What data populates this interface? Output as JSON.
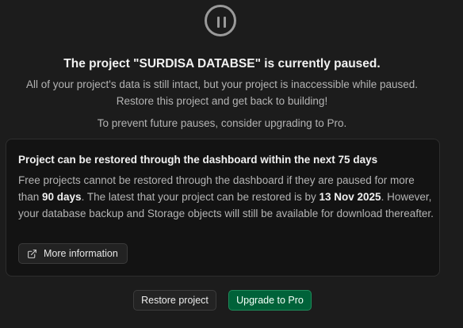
{
  "header": {
    "icon": "pause-circle-icon",
    "title": "The project \"SURDISA DATABSE\" is currently paused.",
    "description_line1": "All of your project's data is still intact, but your project is inaccessible while paused.",
    "description_line2": "Restore this project and get back to building!",
    "upgrade_hint": "To prevent future pauses, consider upgrading to Pro."
  },
  "notice": {
    "title": "Project can be restored through the dashboard within the next 75 days",
    "body_part1": "Free projects cannot be restored through the dashboard if they are paused for more than ",
    "body_days": "90 days",
    "body_part2": ". The latest that your project can be restored is by ",
    "body_date": "13 Nov 2025",
    "body_part3": ". However, your database backup and Storage objects will still be available for download thereafter.",
    "more_info_label": "More information",
    "more_info_icon": "external-link-icon"
  },
  "actions": {
    "restore_label": "Restore project",
    "upgrade_label": "Upgrade to Pro"
  },
  "colors": {
    "background": "#1c1c1c",
    "card_background": "#131313",
    "brand_green": "#006239"
  }
}
